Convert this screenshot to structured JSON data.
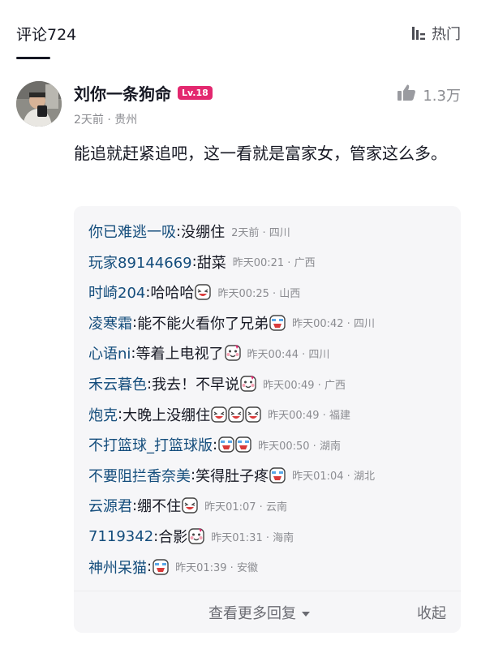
{
  "header": {
    "comment_count": "评论724",
    "sort_label": "热门",
    "sort_icon": "sort-bars-icon"
  },
  "comment": {
    "author": "刘你一条狗命",
    "level": "Lv.18",
    "meta": "2天前 · 贵州",
    "likes": "1.3万",
    "text": "能追就赶紧追吧，这一看就是富家女，管家这么多。"
  },
  "replies": [
    {
      "name": "你已难逃一吸",
      "sep": ": ",
      "text": "没绷住",
      "emojis": [],
      "meta": "2天前 · 四川"
    },
    {
      "name": "玩家89144669",
      "sep": ": ",
      "text": "甜菜",
      "emojis": [],
      "meta": "昨天00:21 · 广西"
    },
    {
      "name": "时崎204",
      "sep": ": ",
      "text": "哈哈哈",
      "emojis": [
        "grin"
      ],
      "meta": "昨天00:25 · 山西"
    },
    {
      "name": "凌寒霜",
      "sep": ": ",
      "text": "能不能火看你了兄弟",
      "emojis": [
        "laugh-cry"
      ],
      "meta": "昨天00:42 · 四川"
    },
    {
      "name": "心语ni",
      "sep": ": ",
      "text": "等着上电视了",
      "emojis": [
        "blush"
      ],
      "meta": "昨天00:44 · 四川"
    },
    {
      "name": "禾云暮色",
      "sep": ": ",
      "text": "我去！不早说",
      "emojis": [
        "blush"
      ],
      "meta": "昨天00:49 · 广西"
    },
    {
      "name": "炮克",
      "sep": ": ",
      "text": "大晚上没绷住",
      "emojis": [
        "grin",
        "grin",
        "grin"
      ],
      "meta": "昨天00:49 · 福建"
    },
    {
      "name": "不打篮球_打篮球版",
      "sep": ": ",
      "text": "",
      "emojis": [
        "laugh-cry",
        "laugh-cry"
      ],
      "meta": "昨天00:50 · 湖南"
    },
    {
      "name": "不要阻拦香奈美",
      "sep": ": ",
      "text": "笑得肚子疼",
      "emojis": [
        "laugh-cry"
      ],
      "meta": "昨天01:04 · 湖北"
    },
    {
      "name": "云源君",
      "sep": ": ",
      "text": "绷不住",
      "emojis": [
        "grin"
      ],
      "meta": "昨天01:07 · 云南"
    },
    {
      "name": "7119342",
      "sep": ": ",
      "text": "合影",
      "emojis": [
        "blush"
      ],
      "meta": "昨天01:31 · 海南"
    },
    {
      "name": "神州呆猫",
      "sep": ": ",
      "text": "",
      "emojis": [
        "laugh-cry"
      ],
      "meta": "昨天01:39 · 安徽"
    }
  ],
  "footer": {
    "more_label": "查看更多回复",
    "collapse_label": "收起"
  },
  "colors": {
    "username": "#144d7c",
    "level_badge": "#e3286f",
    "meta": "#8b8c91"
  }
}
